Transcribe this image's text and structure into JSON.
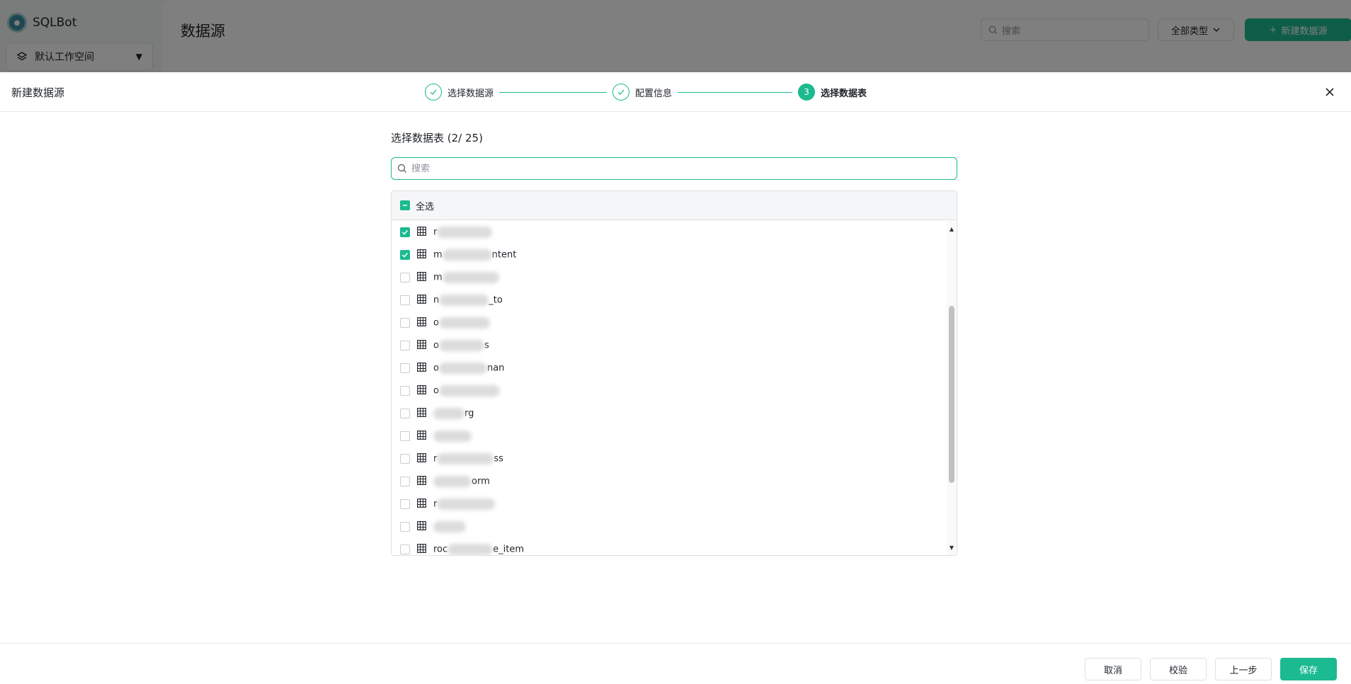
{
  "app": {
    "brand": "SQLBot",
    "workspace": "默认工作空间",
    "page_title": "数据源",
    "search_placeholder": "搜索",
    "type_filter": "全部类型",
    "new_datasource": "新建数据源"
  },
  "drawer": {
    "title": "新建数据源",
    "steps": [
      {
        "label": "选择数据源",
        "status": "done"
      },
      {
        "label": "配置信息",
        "status": "done"
      },
      {
        "number": "3",
        "label": "选择数据表",
        "status": "active"
      }
    ],
    "section_title": "选择数据表 (2/ 25)",
    "search_placeholder": "搜索",
    "select_all": "全选",
    "rows": [
      {
        "prefix": "r",
        "suffix": "",
        "checked": true
      },
      {
        "prefix": "m",
        "suffix": "ntent",
        "checked": true
      },
      {
        "prefix": "m",
        "suffix": "",
        "checked": false
      },
      {
        "prefix": "n",
        "suffix": "_to",
        "checked": false
      },
      {
        "prefix": "o",
        "suffix": "",
        "checked": false
      },
      {
        "prefix": "o",
        "suffix": "s",
        "checked": false
      },
      {
        "prefix": "o",
        "suffix": "nan",
        "checked": false
      },
      {
        "prefix": "o",
        "suffix": "",
        "checked": false
      },
      {
        "prefix": "",
        "suffix": "rg",
        "checked": false
      },
      {
        "prefix": "",
        "suffix": "",
        "checked": false
      },
      {
        "prefix": "r",
        "suffix": "ss",
        "checked": false
      },
      {
        "prefix": "",
        "suffix": "orm",
        "checked": false
      },
      {
        "prefix": "r",
        "suffix": "",
        "checked": false
      },
      {
        "prefix": "",
        "suffix": "",
        "checked": false
      },
      {
        "prefix": "roc",
        "suffix": "e_item",
        "checked": false
      }
    ],
    "buttons": {
      "cancel": "取消",
      "validate": "校验",
      "prev": "上一步",
      "save": "保存"
    }
  },
  "colors": {
    "accent": "#1cba90",
    "border": "#dee0e3",
    "text": "#1f2329"
  }
}
